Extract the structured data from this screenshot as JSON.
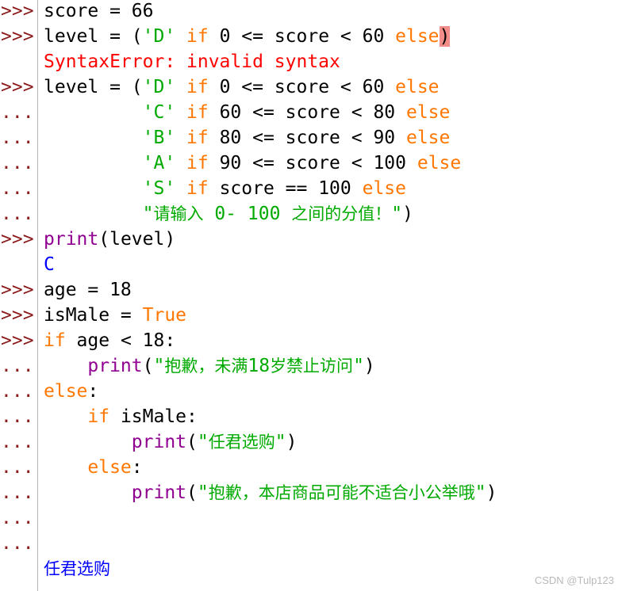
{
  "window": {
    "watermark": "CSDN @Tulp123"
  },
  "colors": {
    "prompt": "#8b1a1a",
    "keyword": "#ff7700",
    "string": "#00aa00",
    "builtin": "#900090",
    "output": "#0000ff",
    "error": "#ff0000",
    "cursor_highlight": "#f38d89",
    "divider": "#b4b4b4"
  },
  "shell": {
    "lines": [
      {
        "prompt": ">>>",
        "tokens": [
          {
            "t": "score = 66",
            "c": ""
          }
        ]
      },
      {
        "prompt": ">>>",
        "tokens": [
          {
            "t": "level = (",
            "c": ""
          },
          {
            "t": "'D'",
            "c": "str"
          },
          {
            "t": " ",
            "c": ""
          },
          {
            "t": "if",
            "c": "kw"
          },
          {
            "t": " 0 <= score < 60 ",
            "c": ""
          },
          {
            "t": "else",
            "c": "kw"
          },
          {
            "t": ")",
            "c": "cursor"
          }
        ]
      },
      {
        "prompt": "",
        "tokens": [
          {
            "t": "SyntaxError: invalid syntax",
            "c": "err"
          }
        ]
      },
      {
        "prompt": ">>>",
        "tokens": [
          {
            "t": "level = (",
            "c": ""
          },
          {
            "t": "'D'",
            "c": "str"
          },
          {
            "t": " ",
            "c": ""
          },
          {
            "t": "if",
            "c": "kw"
          },
          {
            "t": " 0 <= score < 60 ",
            "c": ""
          },
          {
            "t": "else",
            "c": "kw"
          }
        ]
      },
      {
        "prompt": "...",
        "tokens": [
          {
            "t": "         ",
            "c": ""
          },
          {
            "t": "'C'",
            "c": "str"
          },
          {
            "t": " ",
            "c": ""
          },
          {
            "t": "if",
            "c": "kw"
          },
          {
            "t": " 60 <= score < 80 ",
            "c": ""
          },
          {
            "t": "else",
            "c": "kw"
          }
        ]
      },
      {
        "prompt": "...",
        "tokens": [
          {
            "t": "         ",
            "c": ""
          },
          {
            "t": "'B'",
            "c": "str"
          },
          {
            "t": " ",
            "c": ""
          },
          {
            "t": "if",
            "c": "kw"
          },
          {
            "t": " 80 <= score < 90 ",
            "c": ""
          },
          {
            "t": "else",
            "c": "kw"
          }
        ]
      },
      {
        "prompt": "...",
        "tokens": [
          {
            "t": "         ",
            "c": ""
          },
          {
            "t": "'A'",
            "c": "str"
          },
          {
            "t": " ",
            "c": ""
          },
          {
            "t": "if",
            "c": "kw"
          },
          {
            "t": " 90 <= score < 100 ",
            "c": ""
          },
          {
            "t": "else",
            "c": "kw"
          }
        ]
      },
      {
        "prompt": "...",
        "tokens": [
          {
            "t": "         ",
            "c": ""
          },
          {
            "t": "'S'",
            "c": "str"
          },
          {
            "t": " ",
            "c": ""
          },
          {
            "t": "if",
            "c": "kw"
          },
          {
            "t": " score == 100 ",
            "c": ""
          },
          {
            "t": "else",
            "c": "kw"
          }
        ]
      },
      {
        "prompt": "...",
        "tokens": [
          {
            "t": "         ",
            "c": ""
          },
          {
            "t": "\"请输入 0- 100 之间的分值！\"",
            "c": "str"
          },
          {
            "t": ")",
            "c": ""
          }
        ]
      },
      {
        "prompt": ">>>",
        "tokens": [
          {
            "t": "print",
            "c": "builtin"
          },
          {
            "t": "(level)",
            "c": ""
          }
        ]
      },
      {
        "prompt": "",
        "tokens": [
          {
            "t": "C",
            "c": "out"
          }
        ]
      },
      {
        "prompt": ">>>",
        "tokens": [
          {
            "t": "age = 18",
            "c": ""
          }
        ]
      },
      {
        "prompt": ">>>",
        "tokens": [
          {
            "t": "isMale = ",
            "c": ""
          },
          {
            "t": "True",
            "c": "kw"
          }
        ]
      },
      {
        "prompt": ">>>",
        "tokens": [
          {
            "t": "if",
            "c": "kw"
          },
          {
            "t": " age < 18:",
            "c": ""
          }
        ]
      },
      {
        "prompt": "...",
        "tokens": [
          {
            "t": "    ",
            "c": ""
          },
          {
            "t": "print",
            "c": "builtin"
          },
          {
            "t": "(",
            "c": ""
          },
          {
            "t": "\"抱歉，未满18岁禁止访问\"",
            "c": "str"
          },
          {
            "t": ")",
            "c": ""
          }
        ]
      },
      {
        "prompt": "...",
        "tokens": [
          {
            "t": "else",
            "c": "kw"
          },
          {
            "t": ":",
            "c": ""
          }
        ]
      },
      {
        "prompt": "...",
        "tokens": [
          {
            "t": "    ",
            "c": ""
          },
          {
            "t": "if",
            "c": "kw"
          },
          {
            "t": " isMale:",
            "c": ""
          }
        ]
      },
      {
        "prompt": "...",
        "tokens": [
          {
            "t": "        ",
            "c": ""
          },
          {
            "t": "print",
            "c": "builtin"
          },
          {
            "t": "(",
            "c": ""
          },
          {
            "t": "\"任君选购\"",
            "c": "str"
          },
          {
            "t": ")",
            "c": ""
          }
        ]
      },
      {
        "prompt": "...",
        "tokens": [
          {
            "t": "    ",
            "c": ""
          },
          {
            "t": "else",
            "c": "kw"
          },
          {
            "t": ":",
            "c": ""
          }
        ]
      },
      {
        "prompt": "...",
        "tokens": [
          {
            "t": "        ",
            "c": ""
          },
          {
            "t": "print",
            "c": "builtin"
          },
          {
            "t": "(",
            "c": ""
          },
          {
            "t": "\"抱歉，本店商品可能不适合小公举哦\"",
            "c": "str"
          },
          {
            "t": ")",
            "c": ""
          }
        ]
      },
      {
        "prompt": "...",
        "tokens": []
      },
      {
        "prompt": "...",
        "tokens": []
      },
      {
        "prompt": "",
        "tokens": [
          {
            "t": "任君选购",
            "c": "out"
          }
        ]
      }
    ]
  }
}
